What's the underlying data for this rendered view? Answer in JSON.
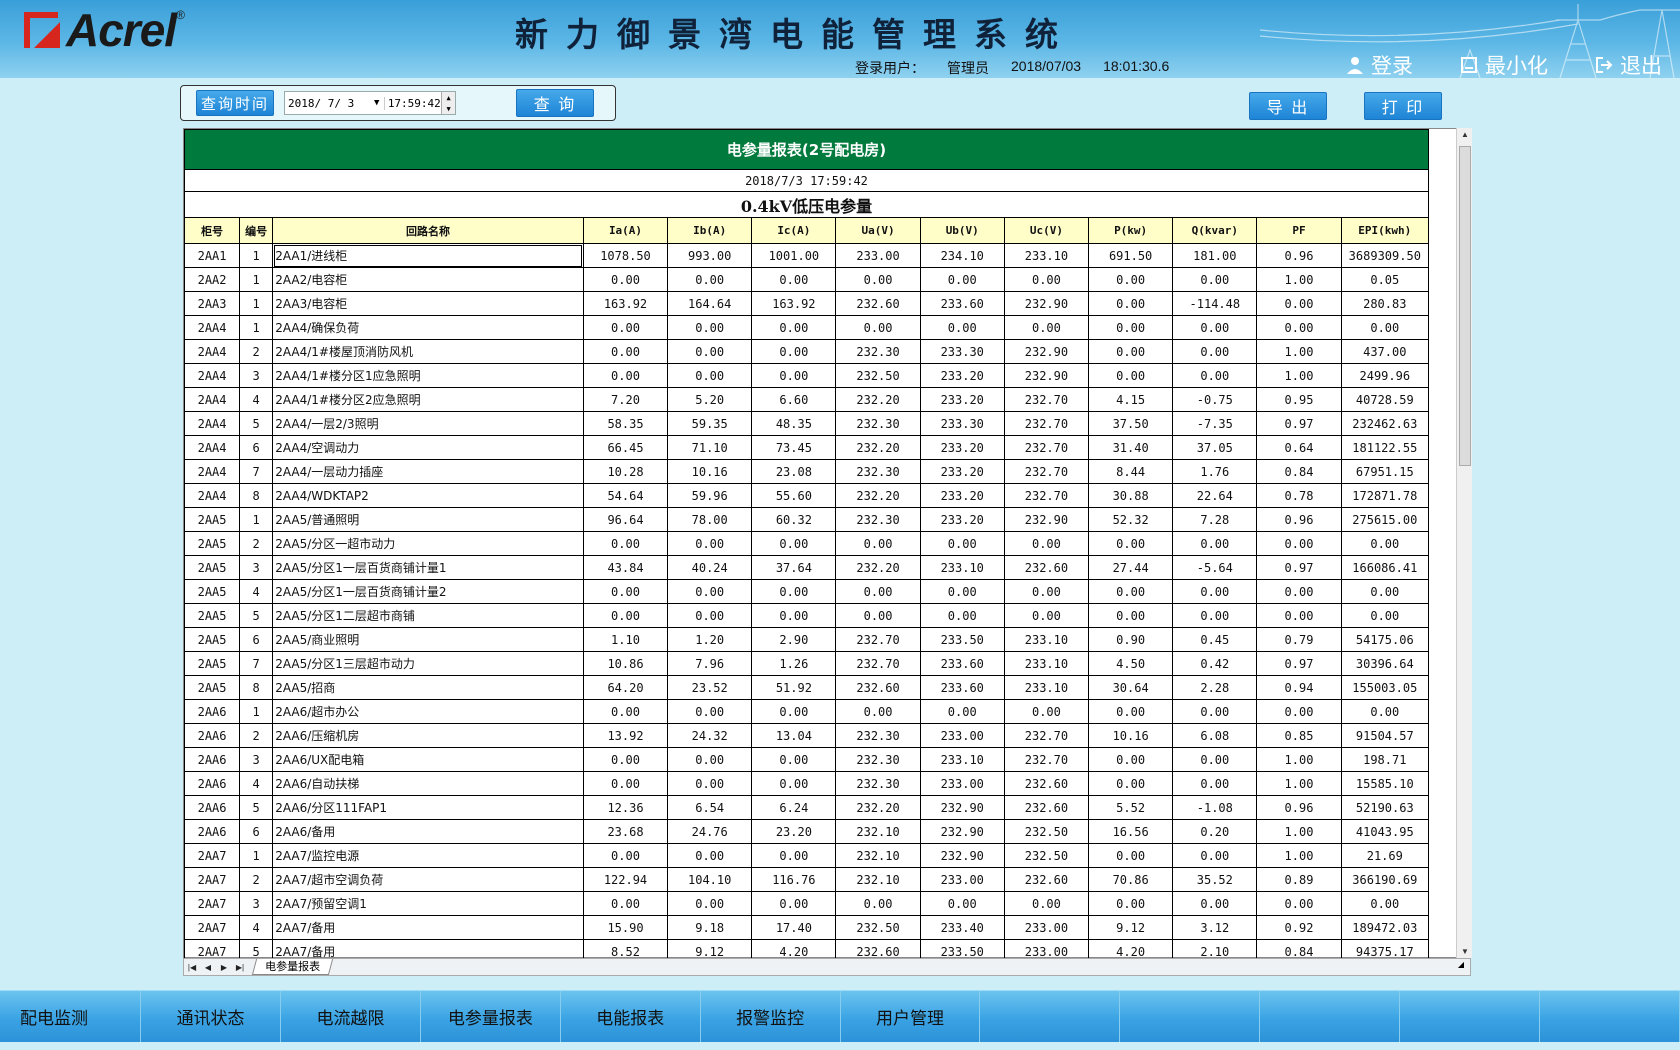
{
  "header": {
    "logo_text": "Acrel",
    "logo_reg": "®",
    "title": "新力御景湾电能管理系统",
    "login_label": "登录用户：",
    "user": "管理员",
    "date": "2018/07/03",
    "time": "18:01:30.6",
    "actions": [
      {
        "label": "登录",
        "icon": "user-icon"
      },
      {
        "label": "最小化",
        "icon": "minimize-icon"
      },
      {
        "label": "退出",
        "icon": "exit-icon"
      }
    ]
  },
  "toolbar": {
    "query_time_label": "查询时间",
    "date_value": "2018/ 7/ 3",
    "time_value": "17:59:42",
    "query_button": "查 询",
    "export_button": "导 出",
    "print_button": "打 印"
  },
  "report": {
    "title": "电参量报表(2号配电房)",
    "timestamp": "2018/7/3 17:59:42",
    "section": "0.4kV低压电参量",
    "columns": [
      "柜号",
      "编号",
      "回路名称",
      "Ia(A)",
      "Ib(A)",
      "Ic(A)",
      "Ua(V)",
      "Ub(V)",
      "Uc(V)",
      "P(kw)",
      "Q(kvar)",
      "PF",
      "EPI(kwh)"
    ],
    "rows": [
      [
        "2AA1",
        "1",
        "2AA1/进线柜",
        "1078.50",
        "993.00",
        "1001.00",
        "233.00",
        "234.10",
        "233.10",
        "691.50",
        "181.00",
        "0.96",
        "3689309.50"
      ],
      [
        "2AA2",
        "1",
        "2AA2/电容柜",
        "0.00",
        "0.00",
        "0.00",
        "0.00",
        "0.00",
        "0.00",
        "0.00",
        "0.00",
        "1.00",
        "0.05"
      ],
      [
        "2AA3",
        "1",
        "2AA3/电容柜",
        "163.92",
        "164.64",
        "163.92",
        "232.60",
        "233.60",
        "232.90",
        "0.00",
        "-114.48",
        "0.00",
        "280.83"
      ],
      [
        "2AA4",
        "1",
        "2AA4/确保负荷",
        "0.00",
        "0.00",
        "0.00",
        "0.00",
        "0.00",
        "0.00",
        "0.00",
        "0.00",
        "0.00",
        "0.00"
      ],
      [
        "2AA4",
        "2",
        "2AA4/1#楼屋顶消防风机",
        "0.00",
        "0.00",
        "0.00",
        "232.30",
        "233.30",
        "232.90",
        "0.00",
        "0.00",
        "1.00",
        "437.00"
      ],
      [
        "2AA4",
        "3",
        "2AA4/1#楼分区1应急照明",
        "0.00",
        "0.00",
        "0.00",
        "232.50",
        "233.20",
        "232.90",
        "0.00",
        "0.00",
        "1.00",
        "2499.96"
      ],
      [
        "2AA4",
        "4",
        "2AA4/1#楼分区2应急照明",
        "7.20",
        "5.20",
        "6.60",
        "232.20",
        "233.20",
        "232.70",
        "4.15",
        "-0.75",
        "0.95",
        "40728.59"
      ],
      [
        "2AA4",
        "5",
        "2AA4/一层2/3照明",
        "58.35",
        "59.35",
        "48.35",
        "232.30",
        "233.30",
        "232.70",
        "37.50",
        "-7.35",
        "0.97",
        "232462.63"
      ],
      [
        "2AA4",
        "6",
        "2AA4/空调动力",
        "66.45",
        "71.10",
        "73.45",
        "232.20",
        "233.20",
        "232.70",
        "31.40",
        "37.05",
        "0.64",
        "181122.55"
      ],
      [
        "2AA4",
        "7",
        "2AA4/一层动力插座",
        "10.28",
        "10.16",
        "23.08",
        "232.30",
        "233.20",
        "232.70",
        "8.44",
        "1.76",
        "0.84",
        "67951.15"
      ],
      [
        "2AA4",
        "8",
        "2AA4/WDKTAP2",
        "54.64",
        "59.96",
        "55.60",
        "232.20",
        "233.20",
        "232.70",
        "30.88",
        "22.64",
        "0.78",
        "172871.78"
      ],
      [
        "2AA5",
        "1",
        "2AA5/普通照明",
        "96.64",
        "78.00",
        "60.32",
        "232.30",
        "233.20",
        "232.90",
        "52.32",
        "7.28",
        "0.96",
        "275615.00"
      ],
      [
        "2AA5",
        "2",
        "2AA5/分区一超市动力",
        "0.00",
        "0.00",
        "0.00",
        "0.00",
        "0.00",
        "0.00",
        "0.00",
        "0.00",
        "0.00",
        "0.00"
      ],
      [
        "2AA5",
        "3",
        "2AA5/分区1一层百货商铺计量1",
        "43.84",
        "40.24",
        "37.64",
        "232.20",
        "233.10",
        "232.60",
        "27.44",
        "-5.64",
        "0.97",
        "166086.41"
      ],
      [
        "2AA5",
        "4",
        "2AA5/分区1一层百货商铺计量2",
        "0.00",
        "0.00",
        "0.00",
        "0.00",
        "0.00",
        "0.00",
        "0.00",
        "0.00",
        "0.00",
        "0.00"
      ],
      [
        "2AA5",
        "5",
        "2AA5/分区1二层超市商铺",
        "0.00",
        "0.00",
        "0.00",
        "0.00",
        "0.00",
        "0.00",
        "0.00",
        "0.00",
        "0.00",
        "0.00"
      ],
      [
        "2AA5",
        "6",
        "2AA5/商业照明",
        "1.10",
        "1.20",
        "2.90",
        "232.70",
        "233.50",
        "233.10",
        "0.90",
        "0.45",
        "0.79",
        "54175.06"
      ],
      [
        "2AA5",
        "7",
        "2AA5/分区1三层超市动力",
        "10.86",
        "7.96",
        "1.26",
        "232.70",
        "233.60",
        "233.10",
        "4.50",
        "0.42",
        "0.97",
        "30396.64"
      ],
      [
        "2AA5",
        "8",
        "2AA5/招商",
        "64.20",
        "23.52",
        "51.92",
        "232.60",
        "233.60",
        "233.10",
        "30.64",
        "2.28",
        "0.94",
        "155003.05"
      ],
      [
        "2AA6",
        "1",
        "2AA6/超市办公",
        "0.00",
        "0.00",
        "0.00",
        "0.00",
        "0.00",
        "0.00",
        "0.00",
        "0.00",
        "0.00",
        "0.00"
      ],
      [
        "2AA6",
        "2",
        "2AA6/压缩机房",
        "13.92",
        "24.32",
        "13.04",
        "232.30",
        "233.00",
        "232.70",
        "10.16",
        "6.08",
        "0.85",
        "91504.57"
      ],
      [
        "2AA6",
        "3",
        "2AA6/UX配电箱",
        "0.00",
        "0.00",
        "0.00",
        "232.30",
        "233.10",
        "232.70",
        "0.00",
        "0.00",
        "1.00",
        "198.71"
      ],
      [
        "2AA6",
        "4",
        "2AA6/自动扶梯",
        "0.00",
        "0.00",
        "0.00",
        "232.30",
        "233.00",
        "232.60",
        "0.00",
        "0.00",
        "1.00",
        "15585.10"
      ],
      [
        "2AA6",
        "5",
        "2AA6/分区111FAP1",
        "12.36",
        "6.54",
        "6.24",
        "232.20",
        "232.90",
        "232.60",
        "5.52",
        "-1.08",
        "0.96",
        "52190.63"
      ],
      [
        "2AA6",
        "6",
        "2AA6/备用",
        "23.68",
        "24.76",
        "23.20",
        "232.10",
        "232.90",
        "232.50",
        "16.56",
        "0.20",
        "1.00",
        "41043.95"
      ],
      [
        "2AA7",
        "1",
        "2AA7/监控电源",
        "0.00",
        "0.00",
        "0.00",
        "232.10",
        "232.90",
        "232.50",
        "0.00",
        "0.00",
        "1.00",
        "21.69"
      ],
      [
        "2AA7",
        "2",
        "2AA7/超市空调负荷",
        "122.94",
        "104.10",
        "116.76",
        "232.10",
        "233.00",
        "232.60",
        "70.86",
        "35.52",
        "0.89",
        "366190.69"
      ],
      [
        "2AA7",
        "3",
        "2AA7/预留空调1",
        "0.00",
        "0.00",
        "0.00",
        "0.00",
        "0.00",
        "0.00",
        "0.00",
        "0.00",
        "0.00",
        "0.00"
      ],
      [
        "2AA7",
        "4",
        "2AA7/备用",
        "15.90",
        "9.18",
        "17.40",
        "232.50",
        "233.40",
        "233.00",
        "9.12",
        "3.12",
        "0.92",
        "189472.03"
      ],
      [
        "2AA7",
        "5",
        "2AA7/备用",
        "8.52",
        "9.12",
        "4.20",
        "232.60",
        "233.50",
        "233.00",
        "4.20",
        "2.10",
        "0.84",
        "94375.17"
      ]
    ]
  },
  "sheet_tab": "电参量报表",
  "nav": {
    "items": [
      "配电监测",
      "通讯状态",
      "电流越限",
      "电参量报表",
      "电能报表",
      "报警监控",
      "用户管理",
      "",
      "",
      "",
      "",
      ""
    ]
  }
}
